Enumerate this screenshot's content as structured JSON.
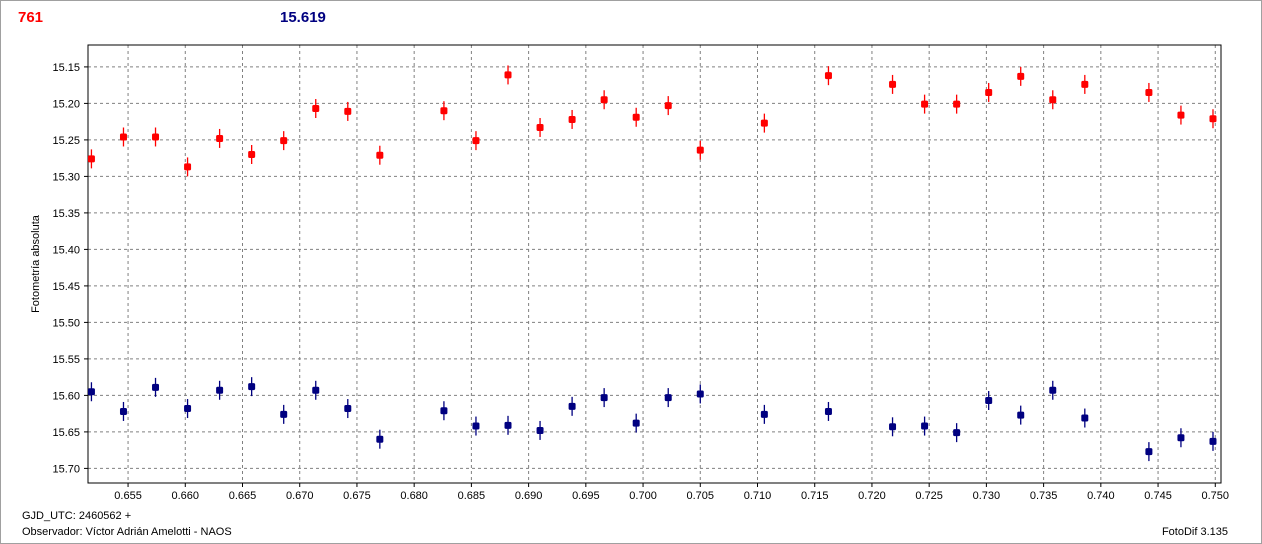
{
  "header": {
    "left_value": "761",
    "right_value": "15.619",
    "left_color": "#ff0000",
    "right_color": "#000080"
  },
  "footer": {
    "gjd": "GJD_UTC: 2460562 +",
    "observer": "Observador: Víctor Adrián Amelotti - NAOS",
    "software": "FotoDif 3.135"
  },
  "chart_data": {
    "type": "scatter",
    "ylabel": "Fotometría absoluta",
    "xlabel": "",
    "xlim": [
      0.6515,
      0.7505
    ],
    "ylim": [
      15.72,
      15.12
    ],
    "y_inverted": true,
    "grid": true,
    "x_ticks": [
      "0.655",
      "0.660",
      "0.665",
      "0.670",
      "0.675",
      "0.680",
      "0.685",
      "0.690",
      "0.695",
      "0.700",
      "0.705",
      "0.710",
      "0.715",
      "0.720",
      "0.725",
      "0.730",
      "0.735",
      "0.740",
      "0.745",
      "0.750"
    ],
    "y_ticks": [
      "15.15",
      "15.20",
      "15.25",
      "15.30",
      "15.35",
      "15.40",
      "15.45",
      "15.50",
      "15.55",
      "15.60",
      "15.65",
      "15.70"
    ],
    "error_bar": 0.013,
    "series": [
      {
        "color": "#ff0000",
        "points": [
          [
            0.6518,
            15.276
          ],
          [
            0.6546,
            15.246
          ],
          [
            0.6574,
            15.246
          ],
          [
            0.6602,
            15.287
          ],
          [
            0.663,
            15.248
          ],
          [
            0.6658,
            15.27
          ],
          [
            0.6686,
            15.251
          ],
          [
            0.6714,
            15.207
          ],
          [
            0.6742,
            15.211
          ],
          [
            0.677,
            15.271
          ],
          [
            0.6826,
            15.21
          ],
          [
            0.6854,
            15.251
          ],
          [
            0.6882,
            15.161
          ],
          [
            0.691,
            15.233
          ],
          [
            0.6938,
            15.222
          ],
          [
            0.6966,
            15.195
          ],
          [
            0.6994,
            15.219
          ],
          [
            0.7022,
            15.203
          ],
          [
            0.705,
            15.264
          ],
          [
            0.7106,
            15.227
          ],
          [
            0.7162,
            15.162
          ],
          [
            0.7218,
            15.174
          ],
          [
            0.7246,
            15.201
          ],
          [
            0.7274,
            15.201
          ],
          [
            0.7302,
            15.185
          ],
          [
            0.733,
            15.163
          ],
          [
            0.7358,
            15.195
          ],
          [
            0.7386,
            15.174
          ],
          [
            0.7442,
            15.185
          ],
          [
            0.747,
            15.216
          ],
          [
            0.7498,
            15.221
          ]
        ]
      },
      {
        "color": "#000080",
        "points": [
          [
            0.6518,
            15.595
          ],
          [
            0.6546,
            15.622
          ],
          [
            0.6574,
            15.589
          ],
          [
            0.6602,
            15.618
          ],
          [
            0.663,
            15.593
          ],
          [
            0.6658,
            15.588
          ],
          [
            0.6686,
            15.626
          ],
          [
            0.6714,
            15.593
          ],
          [
            0.6742,
            15.618
          ],
          [
            0.677,
            15.66
          ],
          [
            0.6826,
            15.621
          ],
          [
            0.6854,
            15.642
          ],
          [
            0.6882,
            15.641
          ],
          [
            0.691,
            15.648
          ],
          [
            0.6938,
            15.615
          ],
          [
            0.6966,
            15.603
          ],
          [
            0.6994,
            15.638
          ],
          [
            0.7022,
            15.603
          ],
          [
            0.705,
            15.598
          ],
          [
            0.7106,
            15.626
          ],
          [
            0.7162,
            15.622
          ],
          [
            0.7218,
            15.643
          ],
          [
            0.7246,
            15.642
          ],
          [
            0.7274,
            15.651
          ],
          [
            0.7302,
            15.607
          ],
          [
            0.733,
            15.627
          ],
          [
            0.7358,
            15.593
          ],
          [
            0.7386,
            15.631
          ],
          [
            0.7442,
            15.677
          ],
          [
            0.747,
            15.658
          ],
          [
            0.7498,
            15.663
          ]
        ]
      }
    ]
  }
}
